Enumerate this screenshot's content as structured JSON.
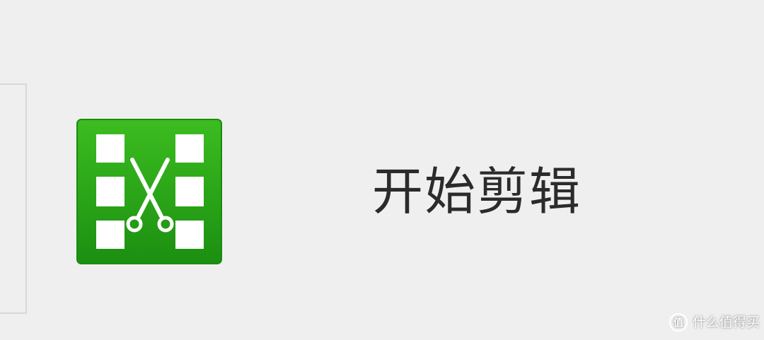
{
  "button": {
    "label": "开始剪辑",
    "icon": "film-scissors-icon"
  },
  "watermark": {
    "text": "什么值得买",
    "icon": "smzdm-logo-icon"
  },
  "colors": {
    "background": "#efefef",
    "icon_green_light": "#36b51c",
    "icon_green_dark": "#1d8f12",
    "label_text": "#2b2b2b",
    "panel_border": "#d8d8d8"
  }
}
